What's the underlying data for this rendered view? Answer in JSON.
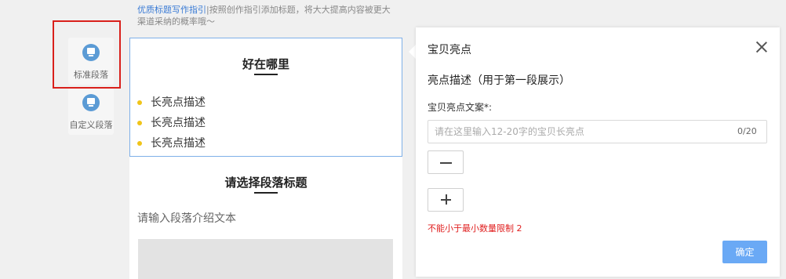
{
  "hint": {
    "link_text": "优质标题写作指引",
    "text": "|按照创作指引添加标题，将大大提高内容被更大渠道采纳的概率哦～"
  },
  "sidebar": {
    "items": [
      {
        "label": "标准段落",
        "icon": "paragraph-icon"
      },
      {
        "label": "自定义段落",
        "icon": "paragraph-icon"
      }
    ]
  },
  "canvas": {
    "selected_block": {
      "title": "好在哪里",
      "bullets": [
        "长亮点描述",
        "长亮点描述",
        "长亮点描述"
      ]
    },
    "next_block": {
      "title": "请选择段落标题",
      "intro_placeholder": "请输入段落介绍文本"
    }
  },
  "panel": {
    "title": "宝贝亮点",
    "section_head": "亮点描述（用于第一段展示）",
    "field_label": "宝贝亮点文案*:",
    "input_placeholder": "请在这里输入12-20字的宝贝长亮点",
    "input_value": "",
    "char_count": "0/20",
    "error": "不能小于最小数量限制 2",
    "confirm_label": "确定"
  },
  "colors": {
    "accent": "#6aa9f5",
    "highlight": "#d9201b",
    "error": "#e02020",
    "bullet": "#f0c419"
  }
}
